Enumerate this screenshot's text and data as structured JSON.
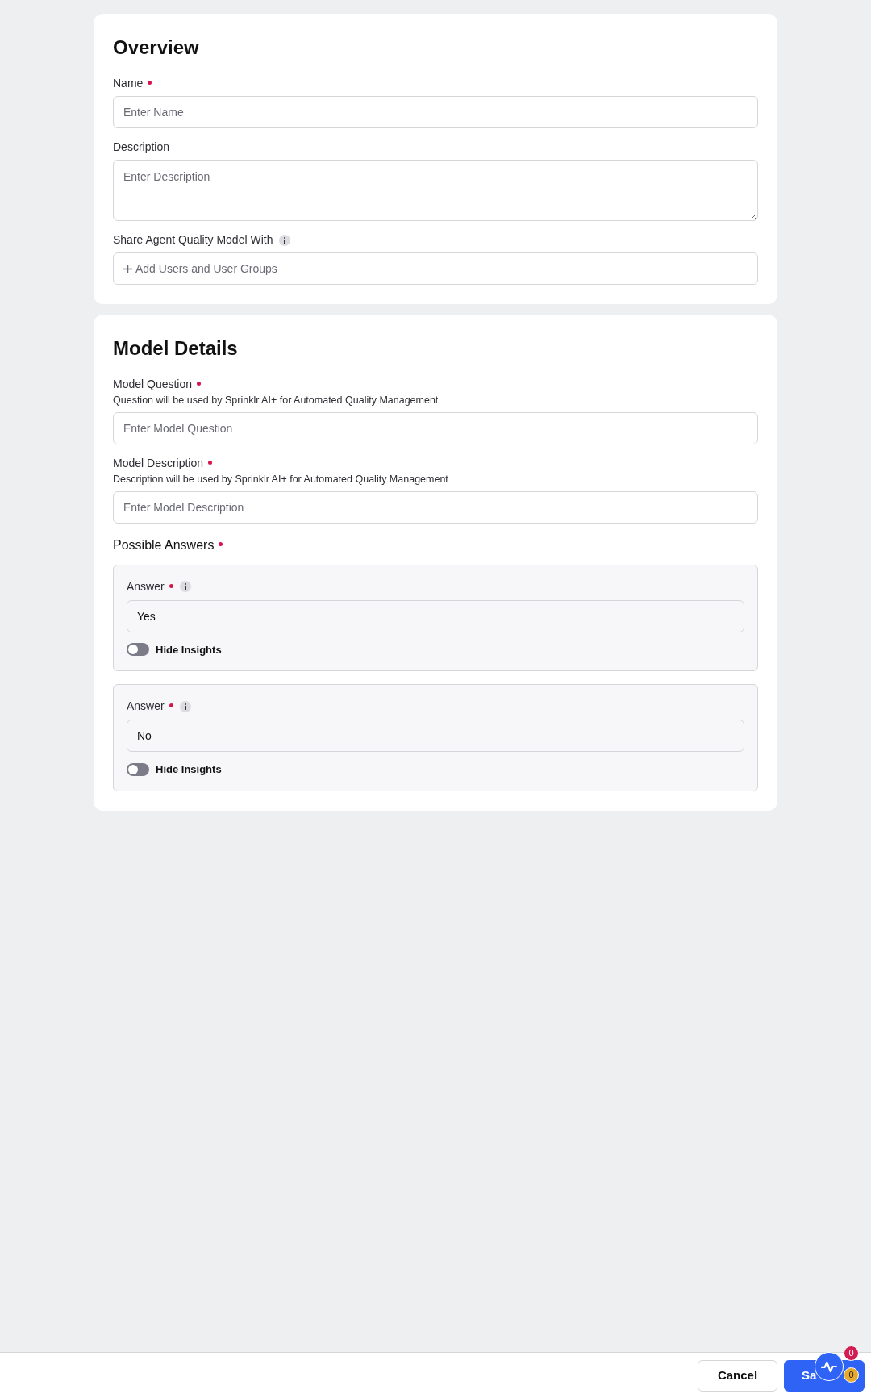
{
  "overview": {
    "title": "Overview",
    "fields": [
      {
        "kind": "input",
        "label": "Name",
        "required": true,
        "info": false,
        "placeholder": "Enter Name"
      },
      {
        "kind": "textarea",
        "label": "Description",
        "required": false,
        "info": false,
        "placeholder": "Enter Description"
      },
      {
        "kind": "picker",
        "label": "Share Agent Quality Model With",
        "required": false,
        "info": true,
        "placeholder": "Add Users and User Groups"
      }
    ]
  },
  "model_details": {
    "title": "Model Details",
    "fields": [
      {
        "label": "Model Question",
        "required": true,
        "hint": "Question will be used by Sprinklr AI+ for Automated Quality Management",
        "placeholder": "Enter Model Question"
      },
      {
        "label": "Model Description",
        "required": true,
        "hint": "Description will be used by Sprinklr AI+ for Automated Quality Management",
        "placeholder": "Enter Model Description"
      }
    ],
    "answers_label": "Possible Answers",
    "answers_required": true,
    "answers": [
      {
        "label": "Answer",
        "required": true,
        "info": true,
        "value": "Yes",
        "toggle_label": "Hide Insights",
        "on": false
      },
      {
        "label": "Answer",
        "required": true,
        "info": true,
        "value": "No",
        "toggle_label": "Hide Insights",
        "on": false
      }
    ]
  },
  "footer": {
    "buttons": [
      {
        "kind": "secondary",
        "label": "Cancel"
      },
      {
        "kind": "primary",
        "label": "Sa"
      }
    ],
    "widget": {
      "top_badge": "0",
      "bottom_badge": "0"
    }
  }
}
